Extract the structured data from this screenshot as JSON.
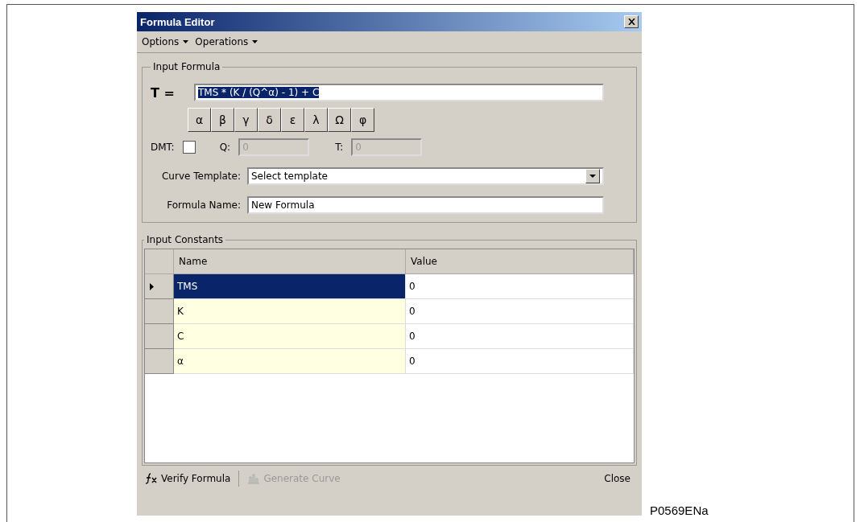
{
  "window": {
    "title": "Formula Editor"
  },
  "menu": [
    {
      "label": "Options"
    },
    {
      "label": "Operations"
    }
  ],
  "input_formula": {
    "legend": "Input Formula",
    "formula_label": "T =",
    "formula_value": "TMS * (K / (Q^α) - 1) + C",
    "formula_selected": true,
    "symbols": [
      "α",
      "β",
      "γ",
      "δ",
      "ε",
      "λ",
      "Ω",
      "φ"
    ],
    "dmt_label": "DMT:",
    "dmt_checked": false,
    "q_label": "Q:",
    "q_value": "0",
    "t_label": "T:",
    "t_value": "0",
    "q_t_disabled": true,
    "curve_template_label": "Curve Template:",
    "curve_template_value": "Select template",
    "formula_name_label": "Formula Name:",
    "formula_name_value": "New Formula"
  },
  "input_constants": {
    "legend": "Input Constants",
    "columns": [
      "Name",
      "Value"
    ],
    "rows": [
      {
        "name": "TMS",
        "value": "0",
        "selected": true
      },
      {
        "name": "K",
        "value": "0",
        "selected": false
      },
      {
        "name": "C",
        "value": "0",
        "selected": false
      },
      {
        "name": "α",
        "value": "0",
        "selected": false
      }
    ]
  },
  "footer": {
    "buttons": [
      {
        "kind": "verify",
        "label": "Verify Formula",
        "disabled": false
      },
      {
        "kind": "generate",
        "label": "Generate Curve",
        "disabled": true
      }
    ],
    "close": "Close"
  },
  "caption": "P0569ENa"
}
